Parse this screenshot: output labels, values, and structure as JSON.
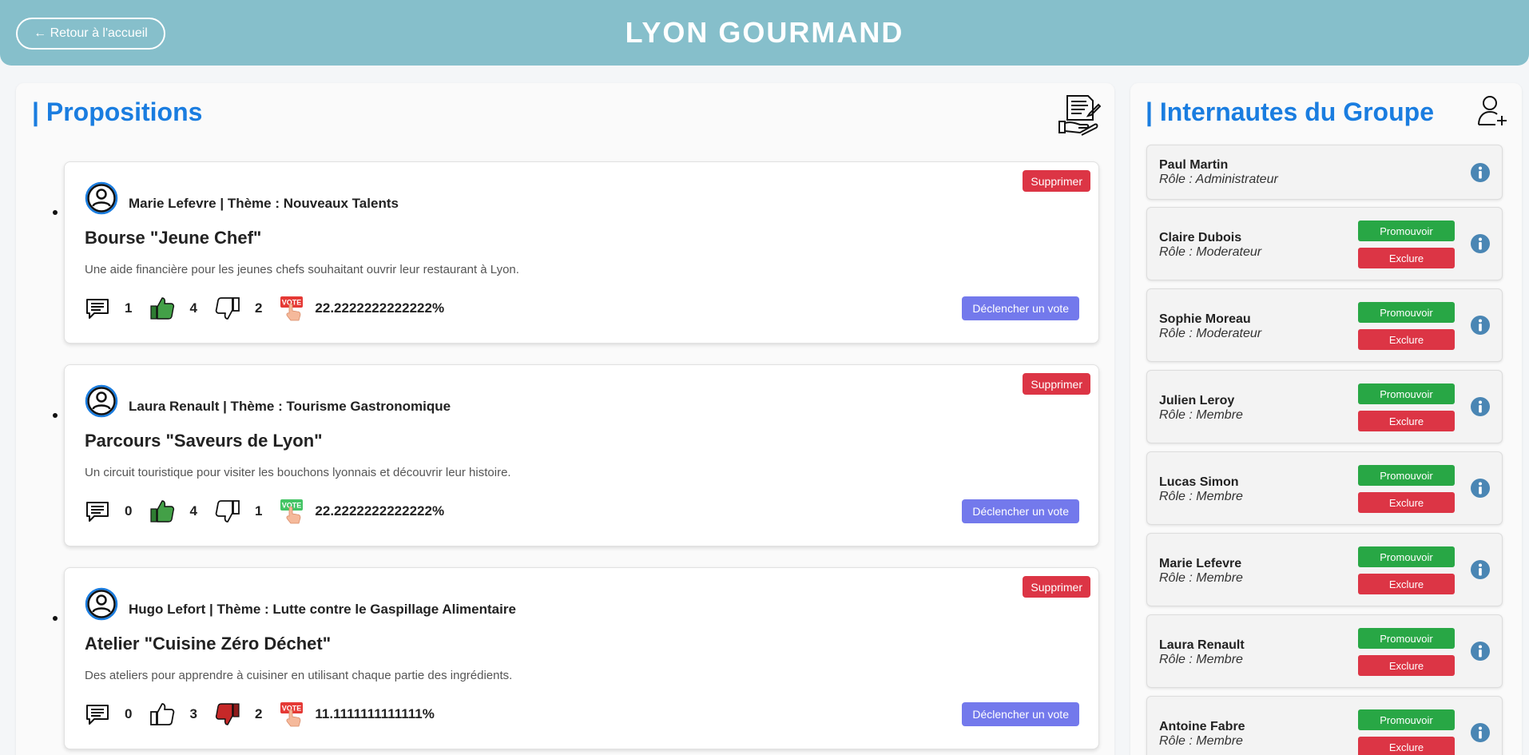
{
  "header": {
    "back_label": "← Retour à l'accueil",
    "site_title": "LYON GOURMAND"
  },
  "propositions": {
    "title": "| Propositions",
    "delete_label": "Supprimer",
    "vote_label": "Déclencher un vote",
    "items": [
      {
        "author_theme": "Marie Lefevre | Thème : Nouveaux Talents",
        "title": "Bourse \"Jeune Chef\"",
        "description": "Une aide financière pour les jeunes chefs souhaitant ouvrir leur restaurant à Lyon.",
        "comments": "1",
        "likes": "4",
        "dislikes": "2",
        "percent": "22.2222222222222%",
        "liked": true,
        "disliked": false,
        "vote_state": "red"
      },
      {
        "author_theme": "Laura Renault | Thème : Tourisme Gastronomique",
        "title": "Parcours \"Saveurs de Lyon\"",
        "description": "Un circuit touristique pour visiter les bouchons lyonnais et découvrir leur histoire.",
        "comments": "0",
        "likes": "4",
        "dislikes": "1",
        "percent": "22.2222222222222%",
        "liked": true,
        "disliked": false,
        "vote_state": "green"
      },
      {
        "author_theme": "Hugo Lefort | Thème : Lutte contre le Gaspillage Alimentaire",
        "title": "Atelier \"Cuisine Zéro Déchet\"",
        "description": "Des ateliers pour apprendre à cuisiner en utilisant chaque partie des ingrédients.",
        "comments": "0",
        "likes": "3",
        "dislikes": "2",
        "percent": "11.1111111111111%",
        "liked": false,
        "disliked": true,
        "vote_state": "red"
      }
    ]
  },
  "members": {
    "title": "| Internautes du Groupe",
    "promote_label": "Promouvoir",
    "exclude_label": "Exclure",
    "items": [
      {
        "name": "Paul Martin",
        "role": "Rôle : Administrateur"
      },
      {
        "name": "Claire Dubois",
        "role": "Rôle : Moderateur"
      },
      {
        "name": "Sophie Moreau",
        "role": "Rôle : Moderateur"
      },
      {
        "name": "Julien Leroy",
        "role": "Rôle : Membre"
      },
      {
        "name": "Lucas Simon",
        "role": "Rôle : Membre"
      },
      {
        "name": "Marie Lefevre",
        "role": "Rôle : Membre"
      },
      {
        "name": "Laura Renault",
        "role": "Rôle : Membre"
      },
      {
        "name": "Antoine Fabre",
        "role": "Rôle : Membre"
      }
    ]
  },
  "colors": {
    "header_bg": "#86bfcb",
    "accent_blue": "#1a7de0",
    "danger": "#dc3545",
    "success": "#28a745",
    "vote_button": "#7379ec",
    "info_icon": "#4a86b4"
  },
  "icons": [
    "comment-icon",
    "thumbs-up-icon",
    "thumbs-down-icon",
    "vote-icon",
    "user-avatar-icon",
    "proposal-document-icon",
    "add-user-icon",
    "info-icon"
  ]
}
